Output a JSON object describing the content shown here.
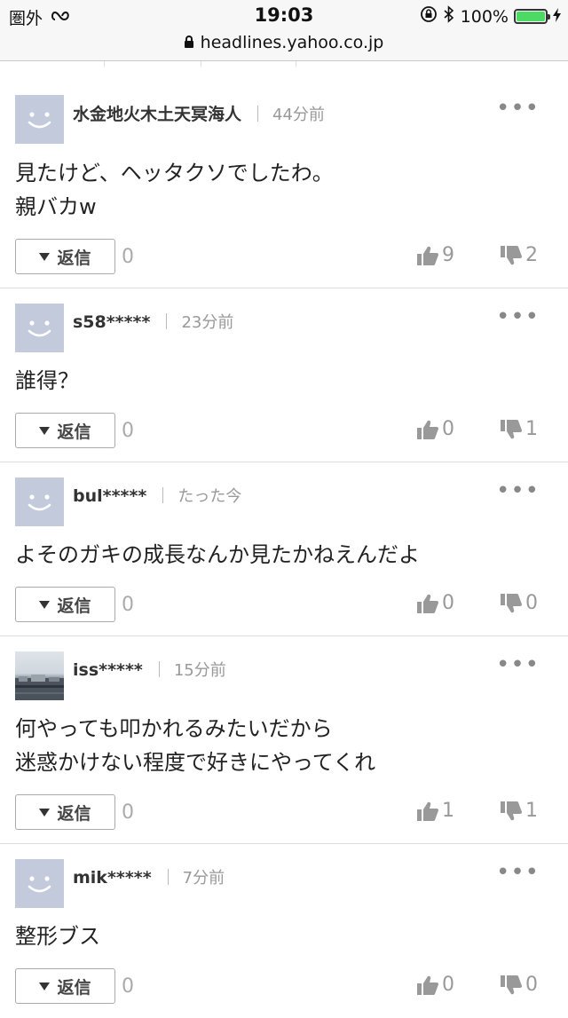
{
  "status_bar": {
    "carrier": "圏外",
    "time": "19:03",
    "battery": "100%",
    "battery_level": 1.0,
    "icons": [
      "wifi-loop-icon",
      "rotation-lock-icon",
      "bluetooth-icon",
      "battery-icon",
      "charging-bolt-icon"
    ]
  },
  "url_bar": {
    "url": "headlines.yahoo.co.jp",
    "icon": "lock-icon"
  },
  "comments": [
    {
      "author": "水金地火木土天冥海人",
      "time": "44分前",
      "text": "見たけど、ヘッタクソでしたわ。\n親バカw",
      "reply_label": "返信",
      "reply_count": "0",
      "likes": "9",
      "dislikes": "2",
      "avatar": "default-face"
    },
    {
      "author": "s58*****",
      "time": "23分前",
      "text": "誰得？",
      "reply_label": "返信",
      "reply_count": "0",
      "likes": "0",
      "dislikes": "1",
      "avatar": "default-face"
    },
    {
      "author": "bul*****",
      "time": "たった今",
      "text": "よそのガキの成長なんか見たかねえんだよ",
      "reply_label": "返信",
      "reply_count": "0",
      "likes": "0",
      "dislikes": "0",
      "avatar": "default-face"
    },
    {
      "author": "iss*****",
      "time": "15分前",
      "text": "何やっても叩かれるみたいだから\n迷惑かけない程度で好きにやってくれ",
      "reply_label": "返信",
      "reply_count": "0",
      "likes": "1",
      "dislikes": "1",
      "avatar": "photo"
    },
    {
      "author": "mik*****",
      "time": "7分前",
      "text": "整形ブス",
      "reply_label": "返信",
      "reply_count": "0",
      "likes": "0",
      "dislikes": "0",
      "avatar": "default-face"
    }
  ]
}
